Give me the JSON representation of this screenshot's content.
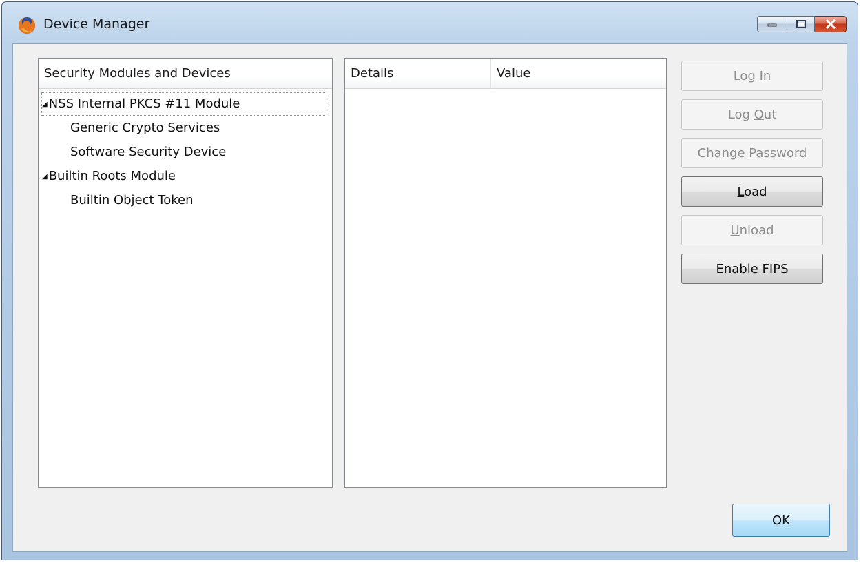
{
  "window": {
    "title": "Device Manager"
  },
  "modules_panel": {
    "header": "Security Modules and Devices",
    "items": [
      {
        "label": "NSS Internal PKCS #11 Module",
        "level": 0,
        "expanded": true,
        "selected": true
      },
      {
        "label": "Generic Crypto Services",
        "level": 1
      },
      {
        "label": "Software Security Device",
        "level": 1
      },
      {
        "label": "Builtin Roots Module",
        "level": 0,
        "expanded": true
      },
      {
        "label": "Builtin Object Token",
        "level": 1
      }
    ]
  },
  "details_panel": {
    "col_details": "Details",
    "col_value": "Value"
  },
  "buttons": {
    "log_in": {
      "pre": "Log ",
      "key": "I",
      "post": "n",
      "enabled": false
    },
    "log_out": {
      "pre": "Log ",
      "key": "O",
      "post": "ut",
      "enabled": false
    },
    "change_password": {
      "pre": "Change ",
      "key": "P",
      "post": "assword",
      "enabled": false
    },
    "load": {
      "pre": "",
      "key": "L",
      "post": "oad",
      "enabled": true
    },
    "unload": {
      "pre": "",
      "key": "U",
      "post": "nload",
      "enabled": false
    },
    "enable_fips": {
      "pre": "Enable ",
      "key": "F",
      "post": "IPS",
      "enabled": true
    },
    "ok": "OK"
  },
  "colors": {
    "titlebar": "#bcd3ea",
    "client_bg": "#f0f0f0",
    "disabled_text": "#8e8e8e"
  }
}
